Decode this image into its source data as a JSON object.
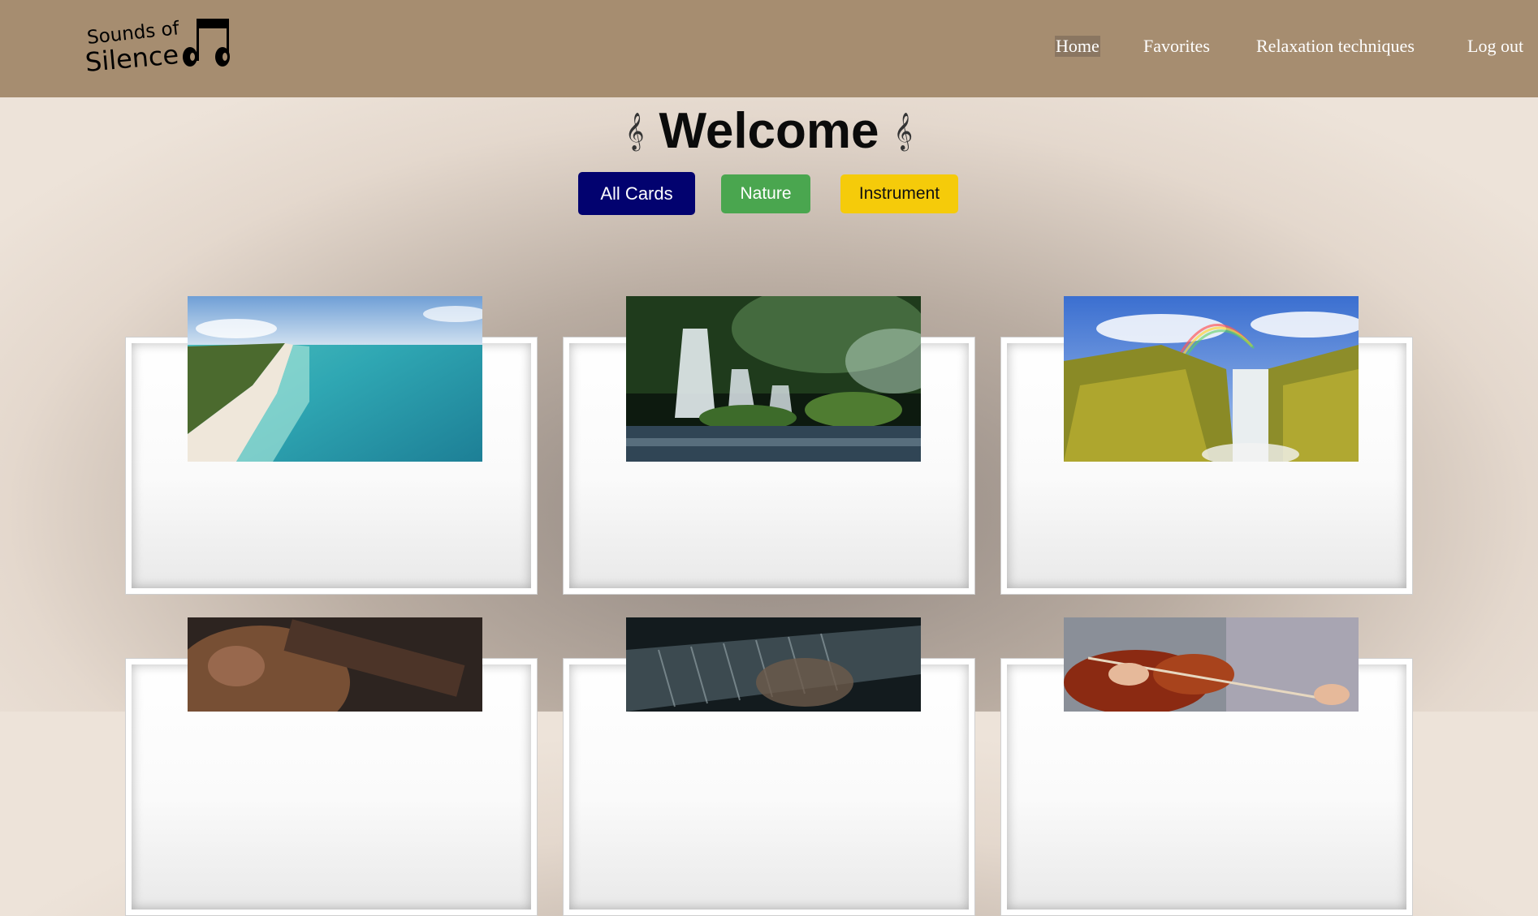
{
  "logo": {
    "line1": "Sounds of",
    "line2": "Silence",
    "icon": "headphones-icon"
  },
  "nav": {
    "items": [
      {
        "label": "Home",
        "active": true
      },
      {
        "label": "Favorites",
        "active": false
      },
      {
        "label": "Relaxation techniques",
        "active": false
      },
      {
        "label": "Log out",
        "active": false
      }
    ]
  },
  "header": {
    "title": "Welcome",
    "decoration_icon": "treble-clef-icon"
  },
  "filters": [
    {
      "label": "All Cards",
      "color": "#02026f",
      "selected": true
    },
    {
      "label": "Nature",
      "color": "#4aa64f",
      "selected": false
    },
    {
      "label": "Instrument",
      "color": "#f5cb0a",
      "selected": false
    }
  ],
  "cards": [
    {
      "image": "beach-image",
      "category": "Nature"
    },
    {
      "image": "forest-waterfall-image",
      "category": "Nature"
    },
    {
      "image": "rainbow-waterfall-image",
      "category": "Nature"
    },
    {
      "image": "guitar-image",
      "category": "Instrument"
    },
    {
      "image": "piano-image",
      "category": "Instrument"
    },
    {
      "image": "violin-image",
      "category": "Instrument"
    }
  ],
  "colors": {
    "navbar": "#a68d70",
    "background": "#ede3d9"
  }
}
